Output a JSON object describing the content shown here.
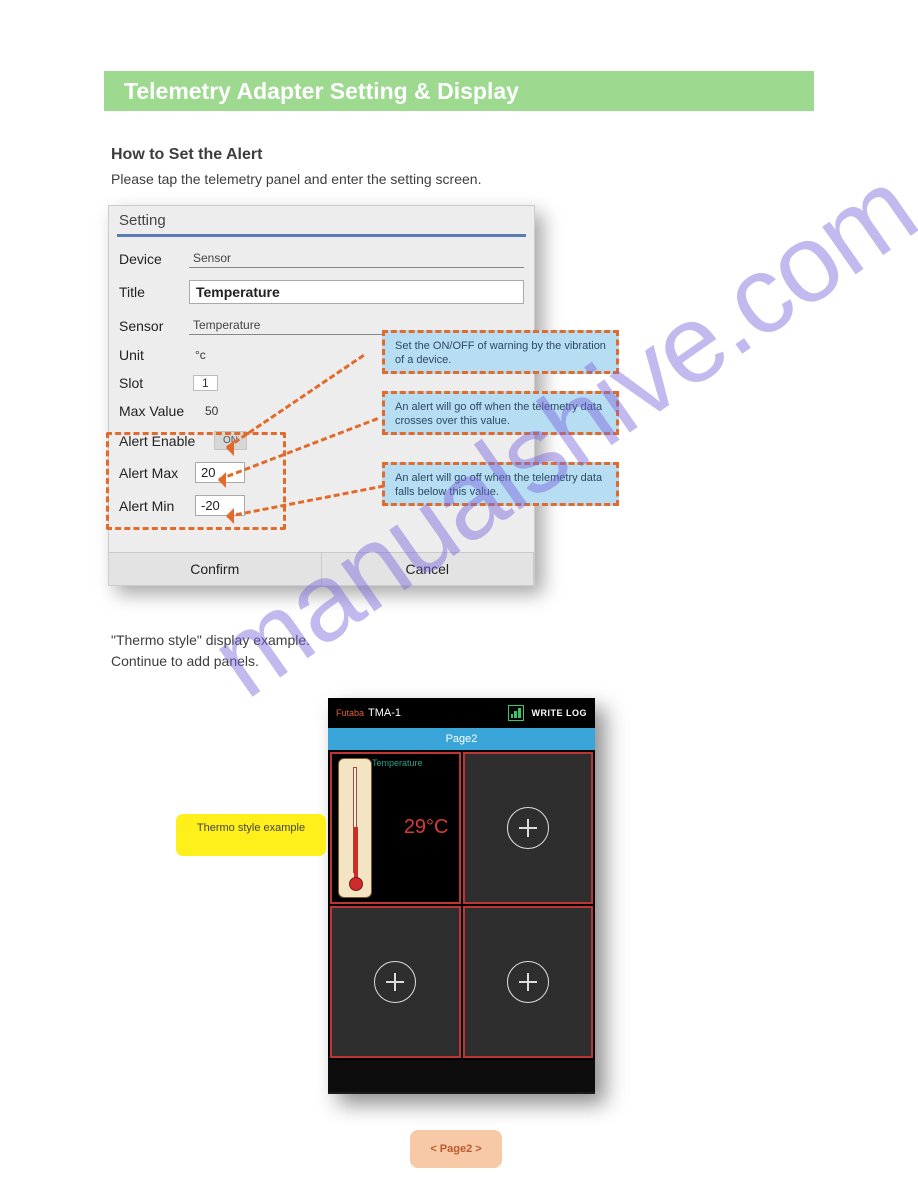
{
  "header": {
    "title": "Telemetry Adapter Setting & Display"
  },
  "subtitle": "How to Set the Alert",
  "instr1": "Please tap the telemetry panel and enter the setting screen.",
  "dialog": {
    "title": "Setting",
    "device_label": "Device",
    "device_value": "Sensor",
    "title_label": "Title",
    "title_value": "Temperature",
    "sensor_label": "Sensor",
    "sensor_value": "Temperature",
    "unit_label": "Unit",
    "unit_value": "°c",
    "slot_label": "Slot",
    "slot_value": "1",
    "maxvalue_label": "Max Value",
    "maxvalue_value": "50",
    "alertenable_label": "Alert Enable",
    "alertenable_value": "ON",
    "alertmax_label": "Alert Max",
    "alertmax_value": "20",
    "alertmin_label": "Alert Min",
    "alertmin_value": "-20",
    "confirm": "Confirm",
    "cancel": "Cancel"
  },
  "callouts": {
    "c1": "Set the ON/OFF of warning by the vibration of a device.",
    "c2": "An alert will go off when the telemetry data crosses over this value.",
    "c3": "An alert will go off when the telemetry data falls below this value."
  },
  "text_after_line1": "\"Thermo style\" display example.",
  "text_after_line2": "Continue to add panels.",
  "phone": {
    "app_brand": "Futaba",
    "app_name": "TMA-1",
    "writelog": "WRITE LOG",
    "tab": "Page2",
    "temp_label": "Temperature",
    "temp_value": "29°C"
  },
  "left_callout": "Thermo style example",
  "bottom_caption": "< Page2 >"
}
